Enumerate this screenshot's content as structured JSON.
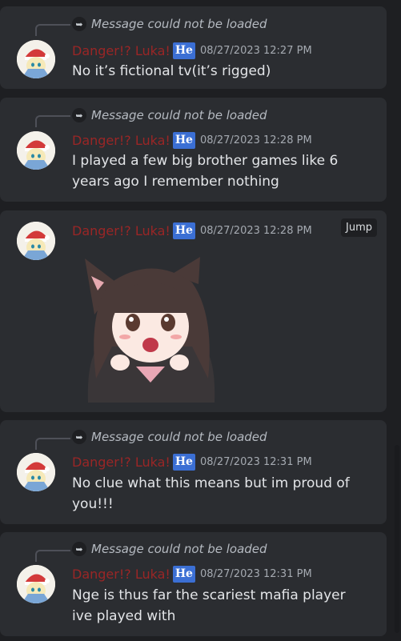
{
  "reply_notice": "Message could not be loaded",
  "author": {
    "name": "Danger!? Luka!",
    "tag": "He"
  },
  "jump_label": "Jump",
  "messages": [
    {
      "time": "08/27/2023 12:27 PM",
      "text": "No it’s fictional tv(it’s rigged)"
    },
    {
      "time": "08/27/2023 12:28 PM",
      "text": "I played a few big brother games like 6 years ago I remember nothing"
    },
    {
      "time": "08/27/2023 12:28 PM",
      "text": ""
    },
    {
      "time": "08/27/2023 12:31 PM",
      "text": "No clue what this means but im proud of you!!!"
    },
    {
      "time": "08/27/2023 12:31 PM",
      "text": "Nge is thus far the scariest mafia player ive played with"
    }
  ],
  "colors": {
    "background": "#1e1f22",
    "card": "#2b2d31",
    "name": "#9a2626",
    "tag": "#3b6fd4"
  },
  "icons": {
    "reply": "reply-arrow-icon"
  }
}
